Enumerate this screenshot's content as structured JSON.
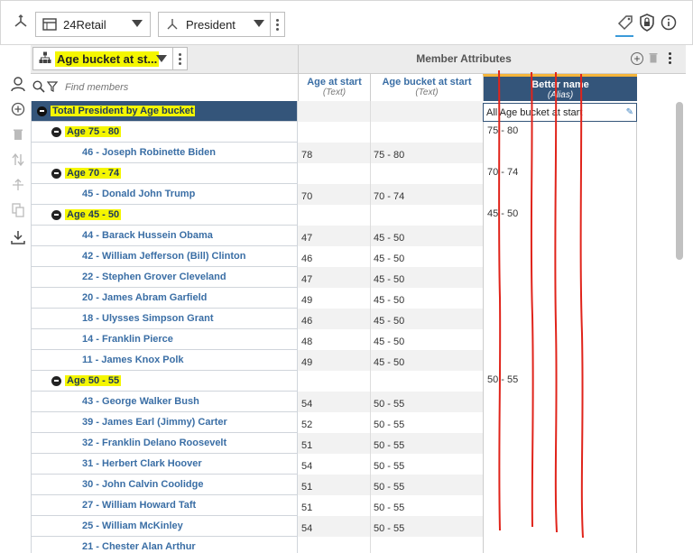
{
  "toolbar": {
    "cube_select": "24Retail",
    "dimension_select": "President"
  },
  "hierarchy_select": {
    "label": "Age bucket at st..."
  },
  "attributes_header": {
    "title": "Member Attributes"
  },
  "search": {
    "placeholder": "Find members"
  },
  "columns": [
    {
      "title": "Age at start",
      "subtitle": "(Text)"
    },
    {
      "title": "Age bucket at start",
      "subtitle": "(Text)"
    },
    {
      "title": "Better name",
      "subtitle": "(Alias)"
    }
  ],
  "rows": [
    {
      "type": "total",
      "name": "Total President by Age bucket",
      "age": "",
      "bucket": "",
      "alias": "All Age bucket at start"
    },
    {
      "type": "bucket",
      "name": "Age 75 - 80",
      "age": "",
      "bucket": "",
      "alias": "75 - 80"
    },
    {
      "type": "leaf",
      "name": "46 - Joseph Robinette Biden",
      "age": "78",
      "bucket": "75 - 80",
      "alias": ""
    },
    {
      "type": "bucket",
      "name": "Age 70 - 74",
      "age": "",
      "bucket": "",
      "alias": "70 - 74"
    },
    {
      "type": "leaf",
      "name": "45 - Donald John Trump",
      "age": "70",
      "bucket": "70 - 74",
      "alias": ""
    },
    {
      "type": "bucket",
      "name": "Age 45 - 50",
      "age": "",
      "bucket": "",
      "alias": "45 - 50"
    },
    {
      "type": "leaf",
      "name": "44 - Barack Hussein Obama",
      "age": "47",
      "bucket": "45 - 50",
      "alias": ""
    },
    {
      "type": "leaf",
      "name": "42 - William Jefferson (Bill) Clinton",
      "age": "46",
      "bucket": "45 - 50",
      "alias": ""
    },
    {
      "type": "leaf",
      "name": "22 - Stephen Grover Cleveland",
      "age": "47",
      "bucket": "45 - 50",
      "alias": ""
    },
    {
      "type": "leaf",
      "name": "20 - James Abram Garfield",
      "age": "49",
      "bucket": "45 - 50",
      "alias": ""
    },
    {
      "type": "leaf",
      "name": "18 - Ulysses Simpson Grant",
      "age": "46",
      "bucket": "45 - 50",
      "alias": ""
    },
    {
      "type": "leaf",
      "name": "14 - Franklin Pierce",
      "age": "48",
      "bucket": "45 - 50",
      "alias": ""
    },
    {
      "type": "leaf",
      "name": "11 - James Knox Polk",
      "age": "49",
      "bucket": "45 - 50",
      "alias": ""
    },
    {
      "type": "bucket",
      "name": "Age 50 - 55",
      "age": "",
      "bucket": "",
      "alias": "50 - 55"
    },
    {
      "type": "leaf",
      "name": "43 - George Walker Bush",
      "age": "54",
      "bucket": "50 - 55",
      "alias": ""
    },
    {
      "type": "leaf",
      "name": "39 - James Earl (Jimmy) Carter",
      "age": "52",
      "bucket": "50 - 55",
      "alias": ""
    },
    {
      "type": "leaf",
      "name": "32 - Franklin Delano Roosevelt",
      "age": "51",
      "bucket": "50 - 55",
      "alias": ""
    },
    {
      "type": "leaf",
      "name": "31 - Herbert Clark Hoover",
      "age": "54",
      "bucket": "50 - 55",
      "alias": ""
    },
    {
      "type": "leaf",
      "name": "30 - John Calvin Coolidge",
      "age": "51",
      "bucket": "50 - 55",
      "alias": ""
    },
    {
      "type": "leaf",
      "name": "27 - William Howard Taft",
      "age": "51",
      "bucket": "50 - 55",
      "alias": ""
    },
    {
      "type": "leaf",
      "name": "25 - William McKinley",
      "age": "54",
      "bucket": "50 - 55",
      "alias": ""
    },
    {
      "type": "leaf",
      "name": "21 - Chester Alan Arthur",
      "age": "",
      "bucket": "",
      "alias": ""
    }
  ],
  "colors": {
    "header_dark": "#34557a",
    "highlight": "#f4f600",
    "link_blue": "#3a6ea5",
    "annotation_red": "#e0241b"
  }
}
